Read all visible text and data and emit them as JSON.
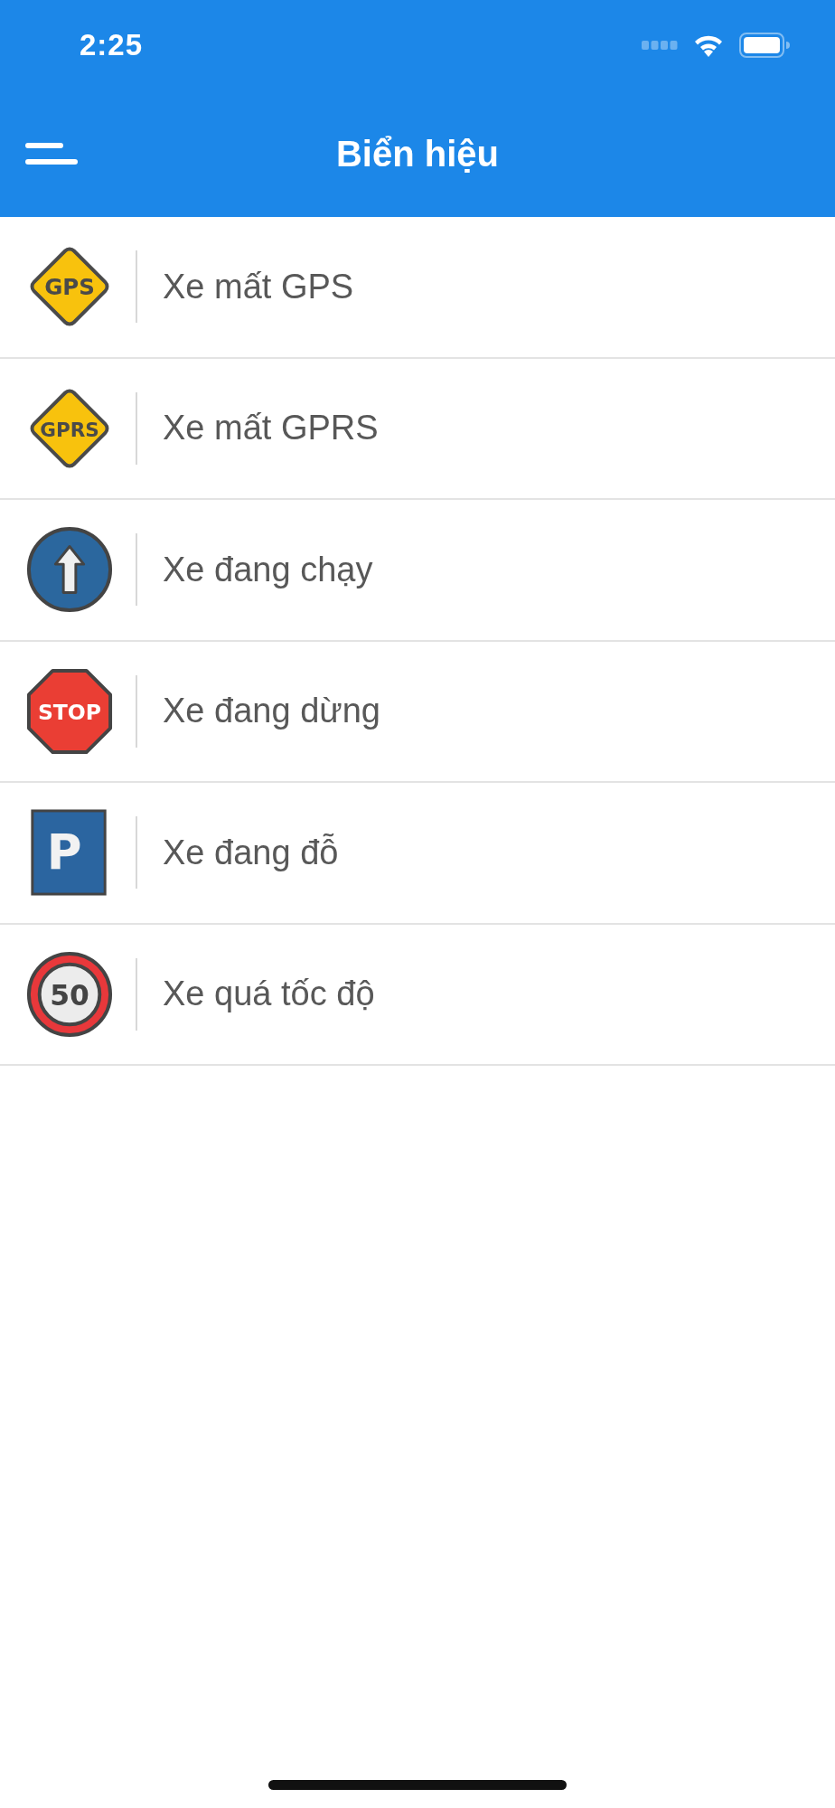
{
  "status_bar": {
    "time": "2:25"
  },
  "nav_bar": {
    "title": "Biển hiệu"
  },
  "items": [
    {
      "kind": "diamond",
      "sign_text": "GPS",
      "label": "Xe mất GPS"
    },
    {
      "kind": "diamond",
      "sign_text": "GPRS",
      "label": "Xe mất GPRS"
    },
    {
      "kind": "arrow",
      "label": "Xe đang chạy"
    },
    {
      "kind": "octagon",
      "sign_text": "STOP",
      "label": "Xe đang dừng"
    },
    {
      "kind": "parking",
      "sign_text": "P",
      "label": "Xe đang đỗ"
    },
    {
      "kind": "speed",
      "sign_text": "50",
      "label": "Xe quá tốc độ"
    }
  ]
}
